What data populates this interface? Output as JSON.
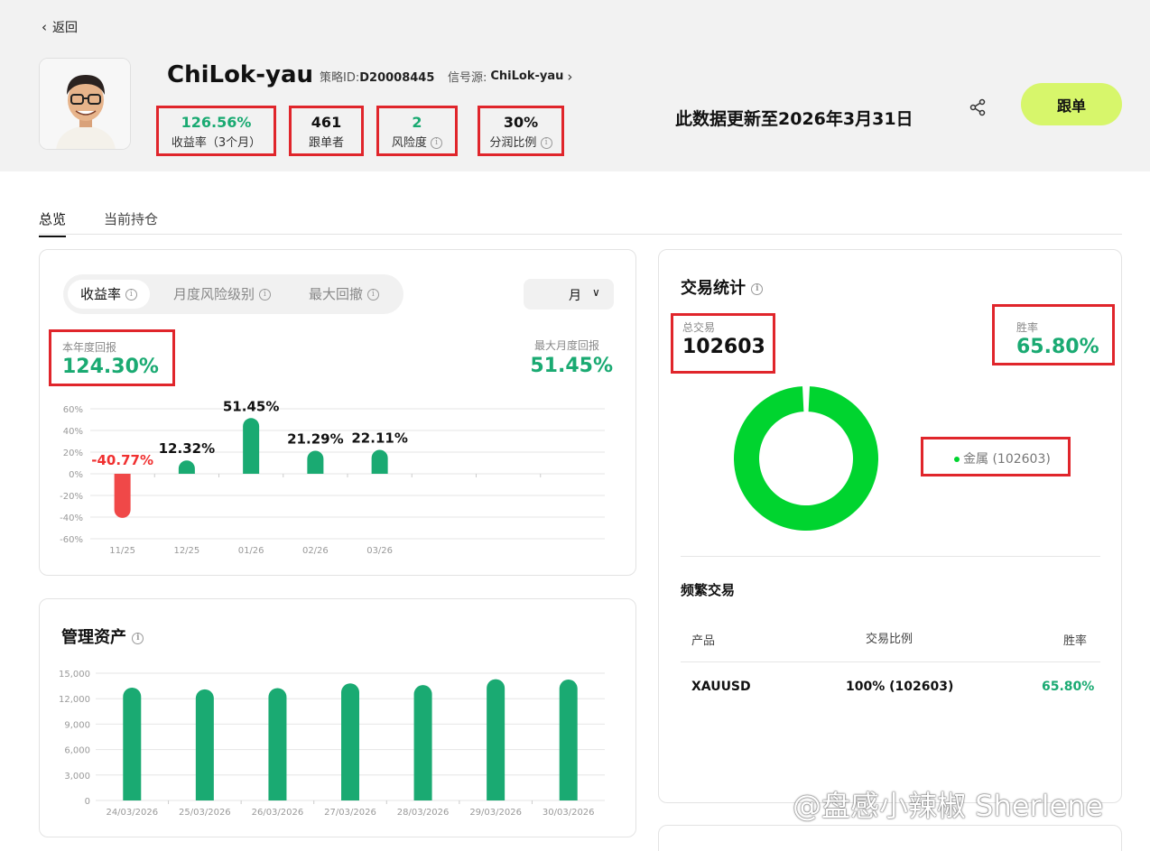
{
  "header": {
    "back_label": "返回",
    "name": "ChiLok-yau",
    "strategy_id_label": "策略ID:",
    "strategy_id": "D20008445",
    "signal_source_label": "信号源:",
    "signal_source": "ChiLok-yau",
    "update_note": "此数据更新至2026年3月31日",
    "follow_label": "跟单"
  },
  "stats": [
    {
      "value": "126.56%",
      "label": "收益率（3个月）"
    },
    {
      "value": "461",
      "label": "跟单者"
    },
    {
      "value": "2",
      "label": "风险度"
    },
    {
      "value": "30%",
      "label": "分润比例"
    }
  ],
  "tabs": [
    "总览",
    "当前持仓"
  ],
  "returns_card": {
    "segments": [
      "收益率",
      "月度风险级别",
      "最大回撤"
    ],
    "period": "月",
    "ytd_label": "本年度回报",
    "ytd_value": "124.30%",
    "max_month_label": "最大月度回报",
    "max_month_value": "51.45%"
  },
  "aum_card": {
    "title": "管理资产"
  },
  "trade_stats": {
    "title": "交易统计",
    "total_label": "总交易",
    "total_value": "102603",
    "winrate_label": "胜率",
    "winrate_value": "65.80%",
    "legend": "金属 (102603)",
    "frequent_title": "频繁交易",
    "columns": [
      "产品",
      "交易比例",
      "胜率"
    ],
    "rows": [
      {
        "product": "XAUUSD",
        "ratio": "100% (102603)",
        "winrate": "65.80%"
      }
    ],
    "donut_color": "#00d42f"
  },
  "watermark": "@盘感小辣椒 Sherlene",
  "colors": {
    "positive": "#1aaa72",
    "negative": "#f04848",
    "accent": "#d7f66b",
    "highlight": "#e0252b"
  },
  "chart_data": [
    {
      "type": "bar",
      "categories": [
        "11/25",
        "12/25",
        "01/26",
        "02/26",
        "03/26"
      ],
      "values": [
        -40.77,
        12.32,
        51.45,
        21.29,
        22.11
      ],
      "data_labels": [
        "-40.77%",
        "12.32%",
        "51.45%",
        "21.29%",
        "22.11%"
      ],
      "ylim": [
        -60,
        60
      ],
      "yticks": [
        "60%",
        "40%",
        "20%",
        "0%",
        "-20%",
        "-40%",
        "-60%"
      ],
      "grid": true
    },
    {
      "type": "bar",
      "categories": [
        "24/03/2026",
        "25/03/2026",
        "26/03/2026",
        "27/03/2026",
        "28/03/2026",
        "29/03/2026",
        "30/03/2026"
      ],
      "values": [
        13300,
        13100,
        13250,
        13800,
        13600,
        14300,
        14250
      ],
      "ylim": [
        0,
        15000
      ],
      "yticks": [
        "15,000",
        "12,000",
        "9,000",
        "6,000",
        "3,000",
        "0"
      ],
      "grid": true
    },
    {
      "type": "pie",
      "labels": [
        "金属"
      ],
      "values": [
        102603
      ]
    }
  ]
}
